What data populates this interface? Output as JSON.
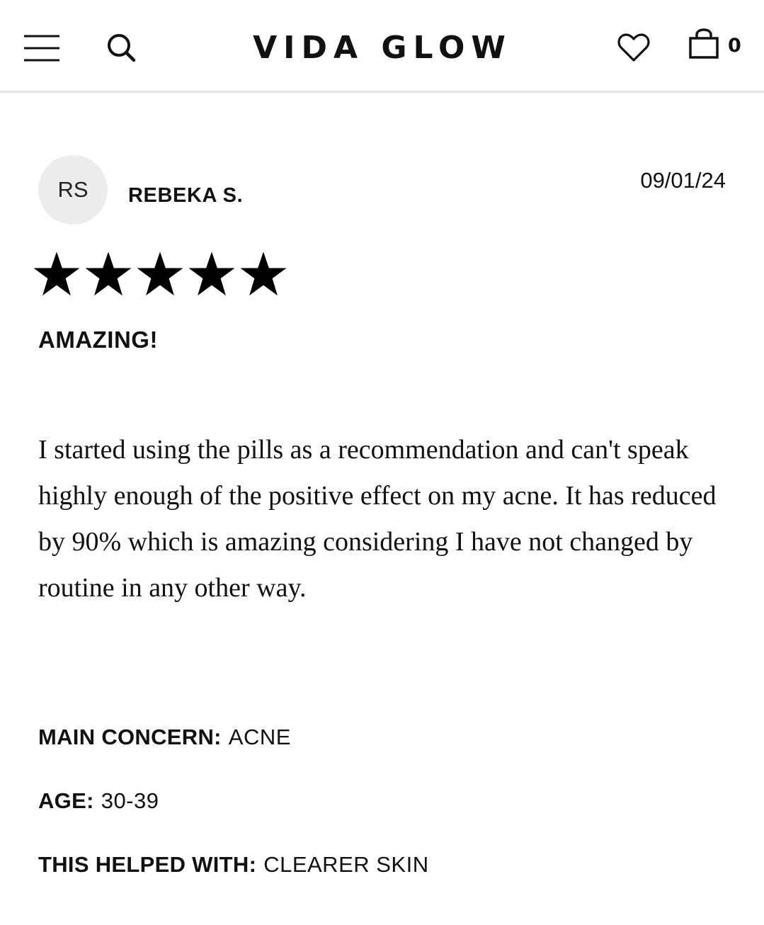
{
  "header": {
    "brand": "VIDA GLOW",
    "cart_count": "0",
    "icons": {
      "menu": "hamburger-menu-icon",
      "search": "search-icon",
      "wishlist": "heart-icon",
      "cart": "shopping-bag-icon"
    }
  },
  "review": {
    "initials": "RS",
    "reviewer": "REBEKA S.",
    "date": "09/01/24",
    "rating": 5,
    "rating_max": 5,
    "title": "AMAZING!",
    "body": "I started using the pills as a recommendation and can't speak highly enough of the positive effect on my acne. It has reduced by 90% which is amazing considering I have not changed by routine in any other way.",
    "attributes": {
      "main_concern_label": "MAIN CONCERN:",
      "main_concern_value": "ACNE",
      "age_label": "AGE:",
      "age_value": "30-39",
      "helped_label": "THIS HELPED WITH:",
      "helped_value": "CLEARER SKIN"
    }
  },
  "colors": {
    "text": "#111111",
    "avatar_bg": "#ececec",
    "divider": "#e4e4e4"
  }
}
